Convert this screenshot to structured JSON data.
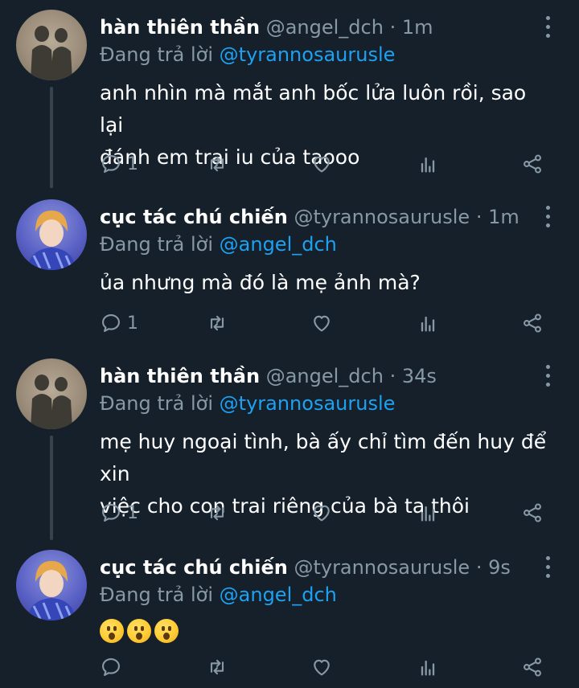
{
  "tweets": [
    {
      "name": "hàn thiên thần",
      "handle": "@angel_dch",
      "time": "· 1m",
      "replying_prefix": "Đang trả lời",
      "replying_to": "@tyrannosaurusle",
      "text_lines": [
        "anh nhìn mà mắt anh bốc lửa luôn rồi, sao lại",
        "đánh em trai iu của taooo"
      ],
      "reply_count": "1",
      "avatar": "shadow-couple-avatar"
    },
    {
      "name": "cục tác chú chiến",
      "handle": "@tyrannosaurusle",
      "time": "· 1m",
      "replying_prefix": "Đang trả lời",
      "replying_to": "@angel_dch",
      "text_lines": [
        "ủa nhưng mà đó là mẹ ảnh mà?"
      ],
      "reply_count": "1",
      "avatar": "person-avatar"
    },
    {
      "name": "hàn thiên thần",
      "handle": "@angel_dch",
      "time": "· 34s",
      "replying_prefix": "Đang trả lời",
      "replying_to": "@tyrannosaurusle",
      "text_lines": [
        "mẹ huy ngoại tình, bà ấy chỉ tìm đến huy để xin",
        "việc cho con trai riêng của bà ta thôi"
      ],
      "reply_count": "1",
      "avatar": "shadow-couple-avatar"
    },
    {
      "name": "cục tác chú chiến",
      "handle": "@tyrannosaurusle",
      "time": "· 9s",
      "replying_prefix": "Đang trả lời",
      "replying_to": "@angel_dch",
      "emoji": [
        "hushed-face-emoji",
        "hushed-face-emoji",
        "hushed-face-emoji"
      ],
      "reply_count": "",
      "avatar": "person-avatar"
    }
  ],
  "icons": {
    "reply": "reply-icon",
    "retweet": "retweet-icon",
    "like": "heart-icon",
    "analytics": "analytics-icon",
    "share": "share-icon",
    "more": "more-options-icon"
  },
  "colors": {
    "background": "#15202b",
    "secondary_text": "#8899a6",
    "mention": "#1da1f2",
    "thread_line": "#38444d"
  }
}
